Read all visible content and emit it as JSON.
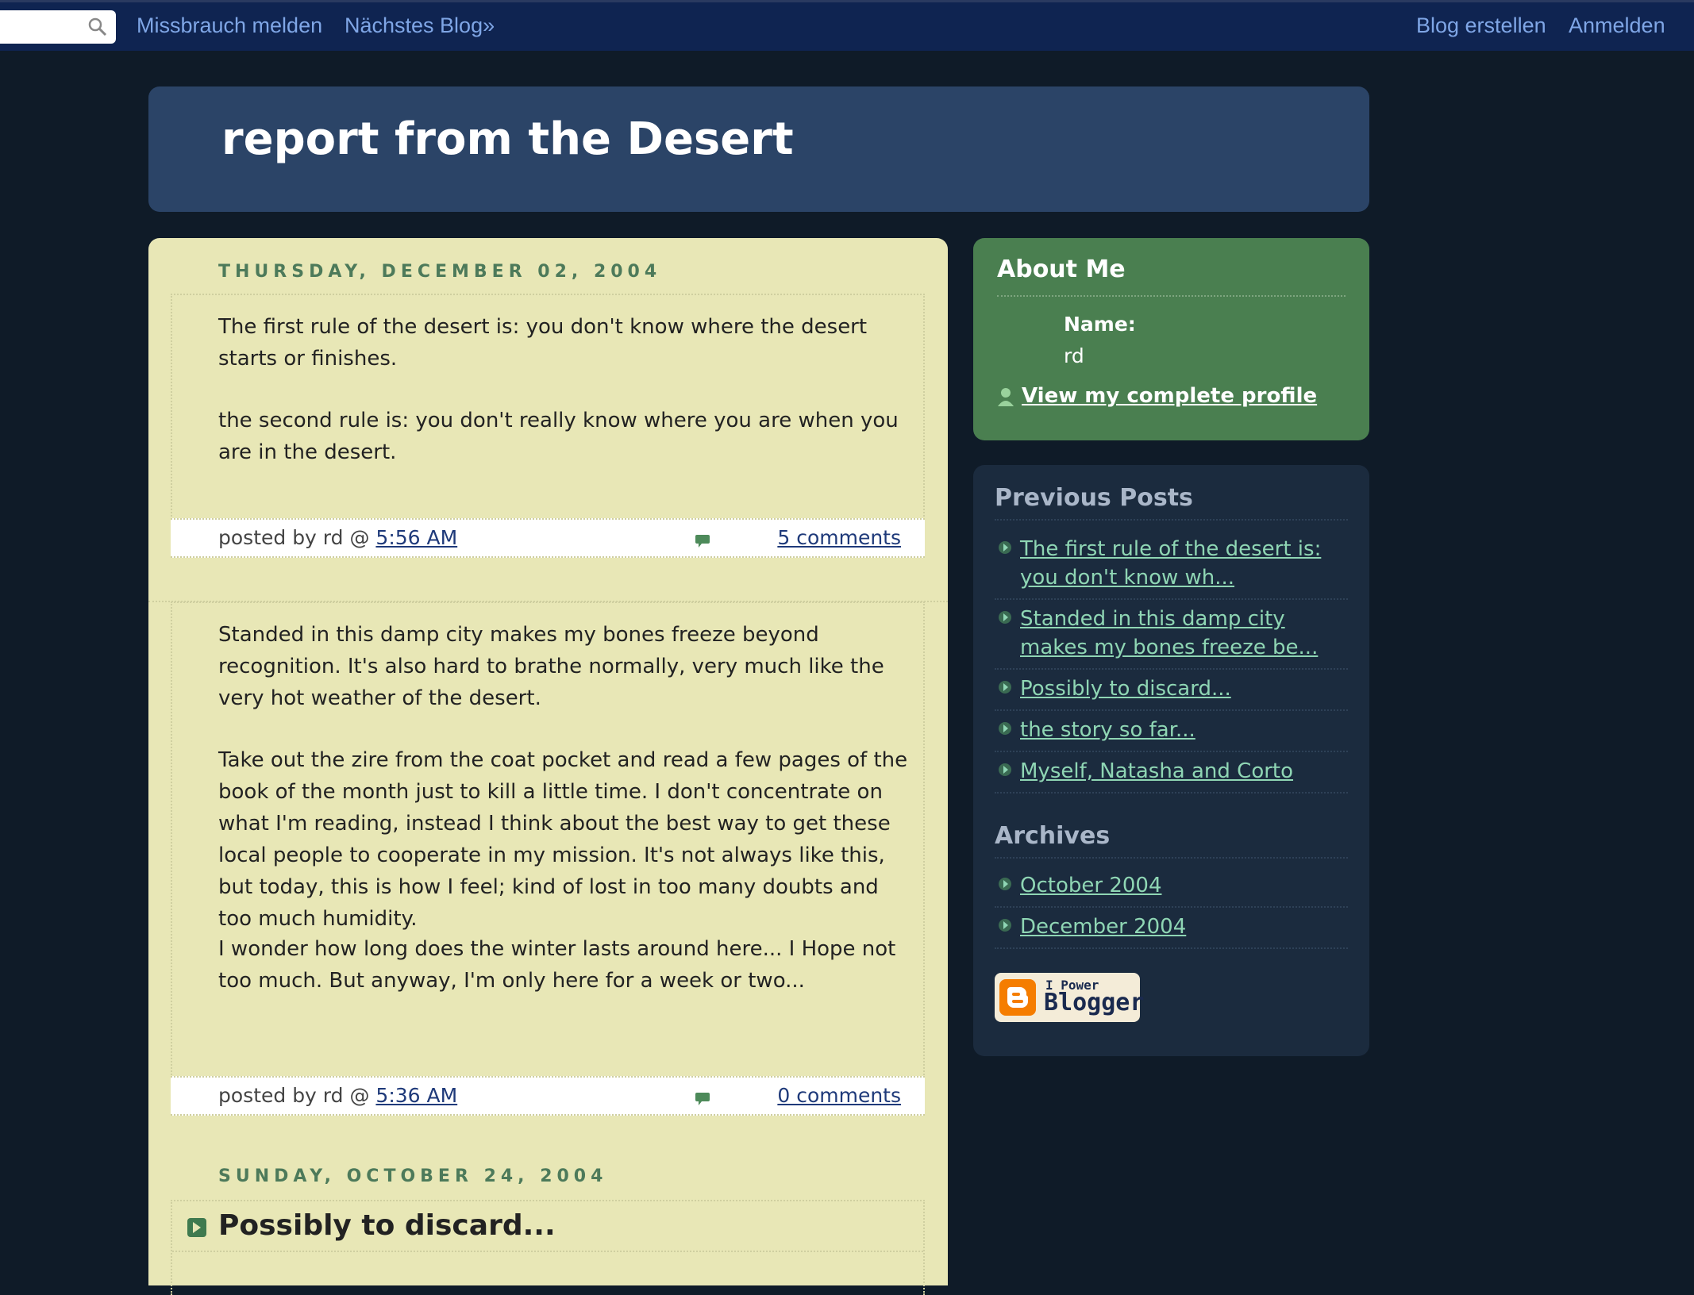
{
  "navbar": {
    "report_abuse": "Missbrauch melden",
    "next_blog": "Nächstes Blog»",
    "create_blog": "Blog erstellen",
    "sign_in": "Anmelden"
  },
  "blog": {
    "title": "report from the Desert"
  },
  "posts": [
    {
      "date": "THURSDAY, DECEMBER 02, 2004",
      "paragraphs": [
        "The first rule of the desert is: you don't know where the desert starts or finishes.",
        "the second rule is: you don't really know where you are when you are in the desert."
      ],
      "posted_by": "posted by rd @",
      "time": "5:56 AM",
      "comments": "5 comments"
    },
    {
      "paragraphs": [
        "Standed in this damp city makes my bones freeze beyond recognition. It's also hard to brathe normally, very much like the very hot weather of the desert.",
        "Take out the zire from the coat pocket and read a few pages of the book of the month just to kill a little time. I don't concentrate on what I'm reading, instead I think about the best way to get these local people to cooperate in my mission. It's not always like this, but today, this is how I feel; kind of lost in too many doubts and too much humidity.",
        "I wonder how long does the winter lasts around here... I Hope not too much. But anyway, I'm only here for a week or two..."
      ],
      "posted_by": "posted by rd @",
      "time": "5:36 AM",
      "comments": "0 comments"
    },
    {
      "date": "SUNDAY, OCTOBER 24, 2004",
      "title": "Possibly to discard..."
    }
  ],
  "about": {
    "heading": "About Me",
    "name_label": "Name:",
    "name_value": "rd",
    "profile_link": "View my complete profile"
  },
  "previous_posts": {
    "heading": "Previous Posts",
    "items": [
      "The first rule of the desert is: you don't know wh...",
      "Standed in this damp city makes my bones freeze be...",
      "Possibly to discard...",
      "the story so far...",
      "Myself, Natasha and Corto"
    ]
  },
  "archives": {
    "heading": "Archives",
    "items": [
      "October 2004",
      "December 2004"
    ]
  },
  "badge": {
    "small": "I Power",
    "big": "Blogger"
  },
  "colors": {
    "page_bg": "#0f1b28",
    "navbar_bg": "#0f2451",
    "header_bg": "#2b4467",
    "main_bg": "#e8e7b6",
    "about_bg": "#4a7f50",
    "sidebar_bg": "#1b2b3e",
    "link_green": "#8fd6b4"
  }
}
